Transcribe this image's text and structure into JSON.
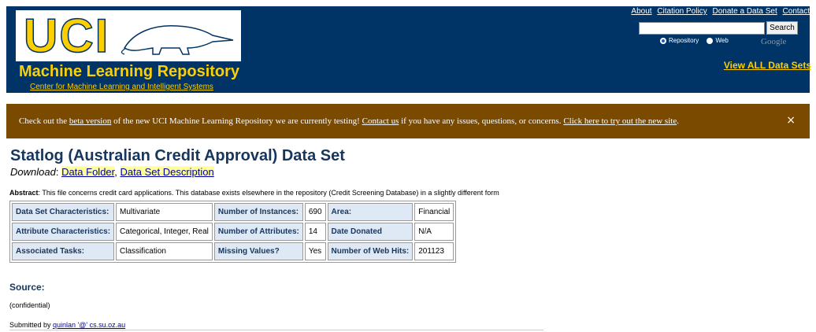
{
  "header": {
    "logo_text": "UCI",
    "title": "Machine Learning Repository",
    "subtitle": "Center for Machine Learning and Intelligent Systems",
    "top_links": [
      "About",
      "Citation Policy",
      "Donate a Data Set",
      "Contact"
    ],
    "search": {
      "value": "",
      "button_label": "Search"
    },
    "radio_options": [
      {
        "label": "Repository",
        "selected": true
      },
      {
        "label": "Web",
        "selected": false
      }
    ],
    "google_label": "Google",
    "view_all_label": "View ALL Data Sets"
  },
  "banner": {
    "part1": "Check out the ",
    "link1": "beta version",
    "part2": " of the new UCI Machine Learning Repository we are currently testing! ",
    "link2": "Contact us",
    "part3": " if you have any issues, questions, or concerns. ",
    "link3": "Click here to try out the new site",
    "part4": ".",
    "close": "×"
  },
  "page": {
    "title": "Statlog (Australian Credit Approval) Data Set",
    "download_label": "Download",
    "download_links": [
      "Data Folder",
      "Data Set Description"
    ],
    "abstract_label": "Abstract",
    "abstract_text": ": This file concerns credit card applications. This database exists elsewhere in the repository (Credit Screening Database) in a slightly different form"
  },
  "info_table": [
    [
      "Data Set Characteristics:",
      "Multivariate",
      "Number of Instances:",
      "690",
      "Area:",
      "Financial"
    ],
    [
      "Attribute Characteristics:",
      "Categorical, Integer, Real",
      "Number of Attributes:",
      "14",
      "Date Donated",
      "N/A"
    ],
    [
      "Associated Tasks:",
      "Classification",
      "Missing Values?",
      "Yes",
      "Number of Web Hits:",
      "201123"
    ]
  ],
  "source": {
    "heading": "Source:",
    "value": "(confidential)",
    "submitted_label": "Submitted by ",
    "submitted_link": "quinlan '@' cs.su.oz.au"
  },
  "colors": {
    "header_bg": "#003366",
    "accent": "#fdcf00",
    "banner_bg": "#7a4a00"
  }
}
